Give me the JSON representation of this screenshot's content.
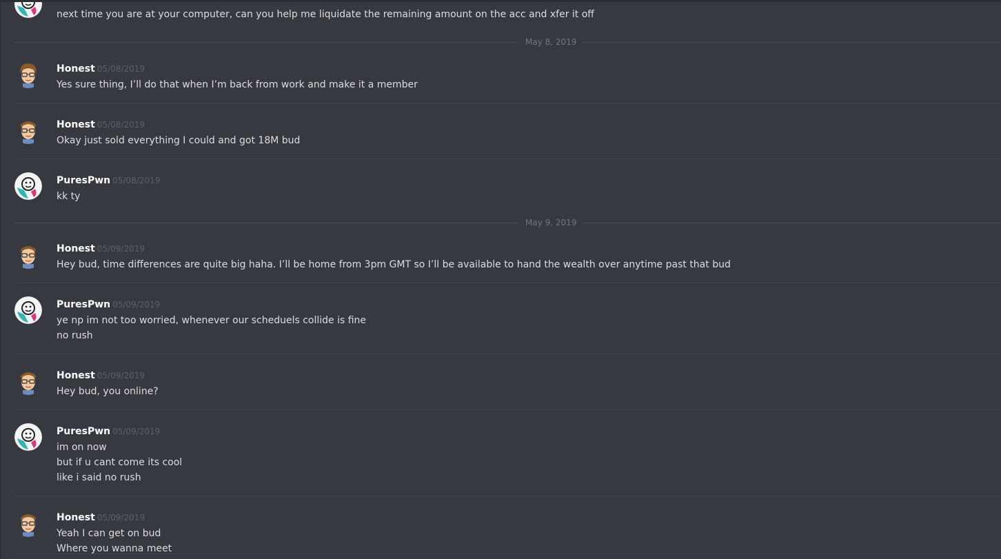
{
  "top_message": {
    "text": "next time you are at your computer, can you help me liquidate the remaining amount on the acc and xfer it off"
  },
  "dividers": [
    {
      "label": "May 8, 2019"
    },
    {
      "label": "May 9, 2019"
    }
  ],
  "messages": [
    {
      "user": "Honest",
      "time": "05/08/2019",
      "lines": [
        "Yes sure thing, I’ll do that when I’m back from work and make it a member"
      ]
    },
    {
      "user": "Honest",
      "time": "05/08/2019",
      "lines": [
        "Okay just sold everything I could and got 18M bud"
      ]
    },
    {
      "user": "PuresPwn",
      "time": "05/08/2019",
      "lines": [
        "kk ty"
      ]
    },
    {
      "user": "Honest",
      "time": "05/09/2019",
      "lines": [
        "Hey bud, time differences are quite big haha. I’ll be home from 3pm GMT so I’ll be available to hand the wealth over anytime past that bud"
      ]
    },
    {
      "user": "PuresPwn",
      "time": "05/09/2019",
      "lines": [
        "ye np im not too worried, whenever our scheduels collide is fine",
        "no rush"
      ]
    },
    {
      "user": "Honest",
      "time": "05/09/2019",
      "lines": [
        "Hey bud, you online?"
      ]
    },
    {
      "user": "PuresPwn",
      "time": "05/09/2019",
      "lines": [
        "im on now",
        "but if u cant come its cool",
        "like i said no rush"
      ]
    },
    {
      "user": "Honest",
      "time": "05/09/2019",
      "lines": [
        "Yeah I can get on bud",
        "Where you wanna meet"
      ]
    }
  ],
  "icons": {
    "honest_avatar": "cartoon-face-avatar-icon",
    "purespwn_avatar": "smiley-logo-avatar-icon"
  }
}
